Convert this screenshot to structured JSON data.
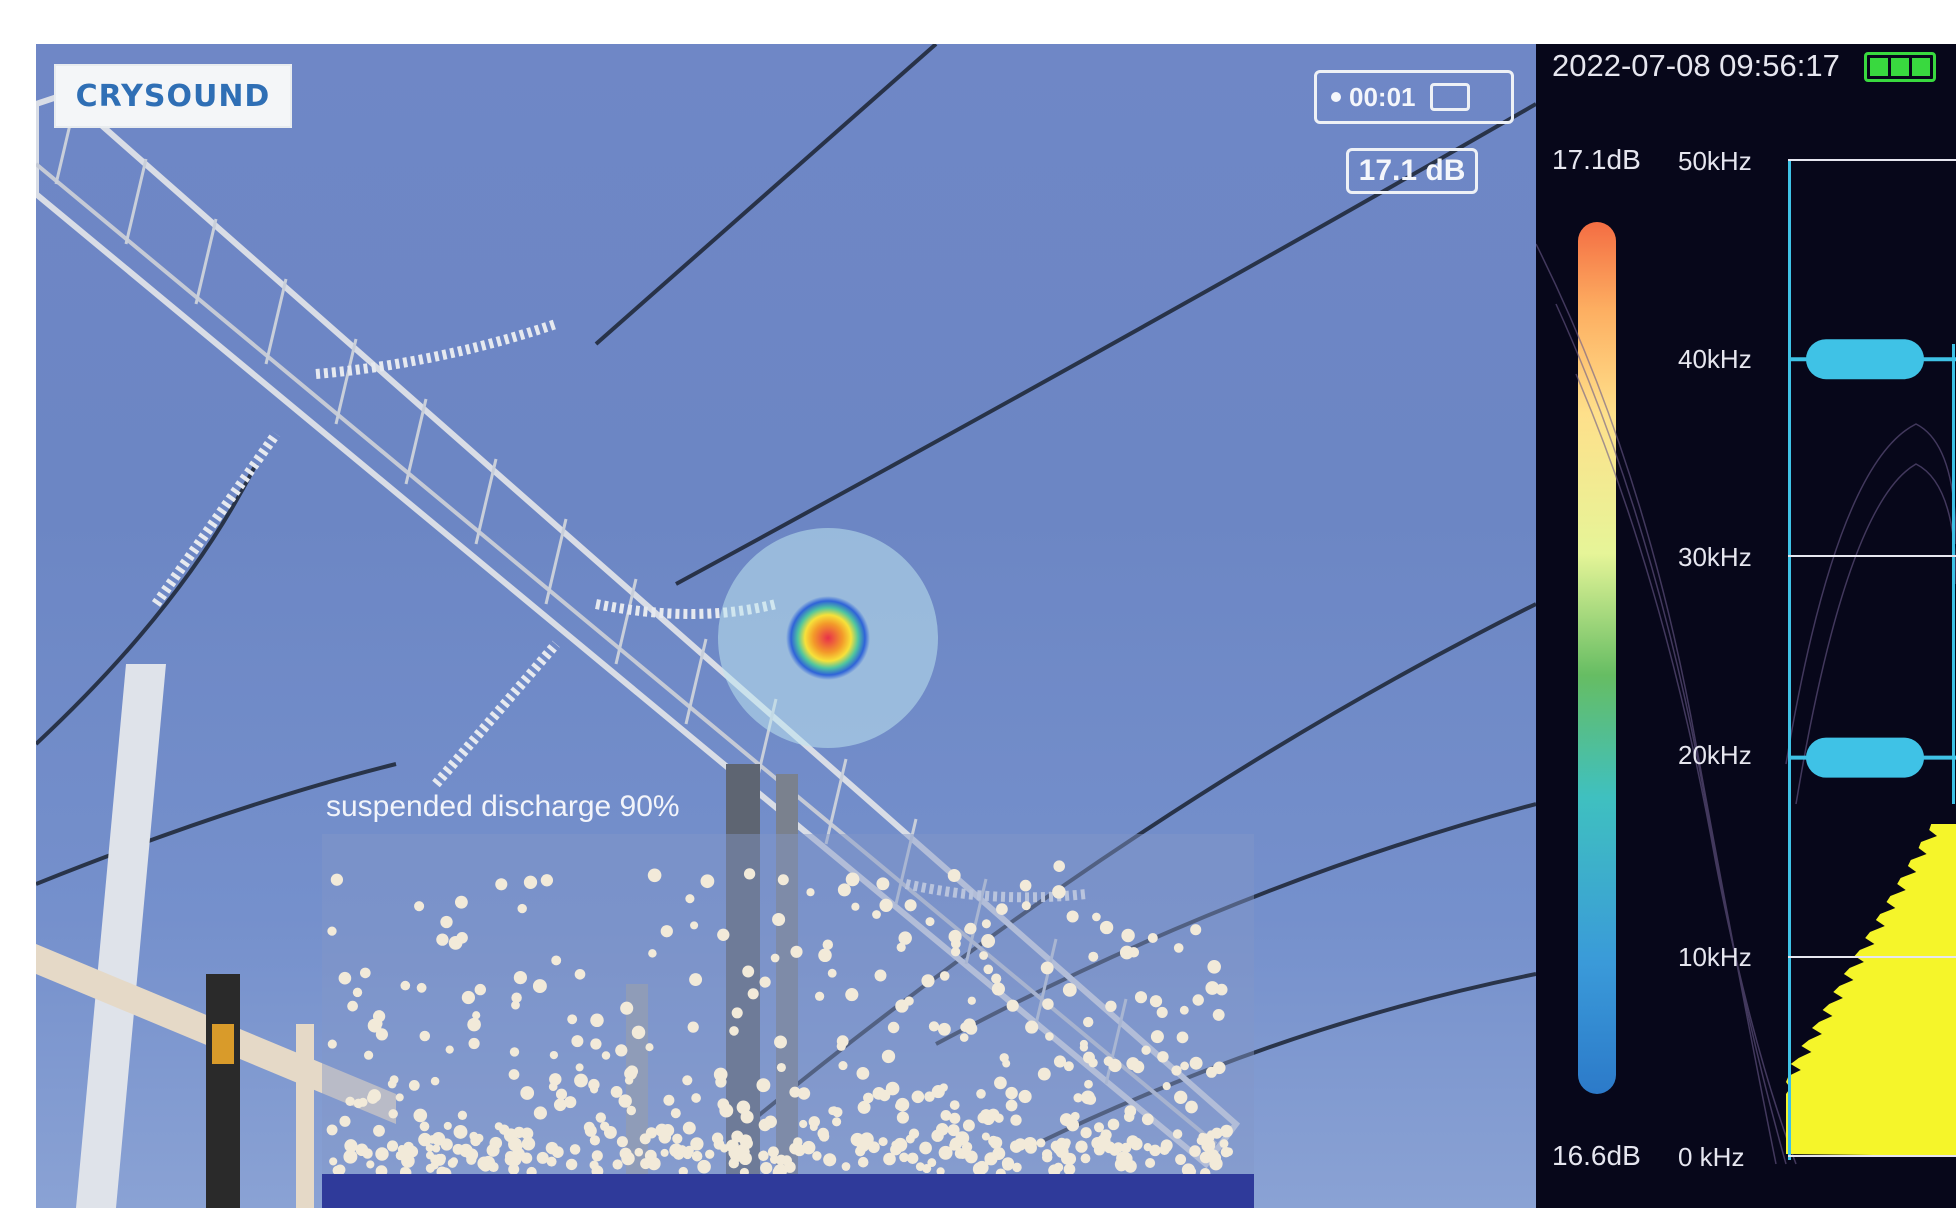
{
  "logo": {
    "text": "CRYSOUND"
  },
  "recording": {
    "timer": "00:01",
    "icon": "camera-icon"
  },
  "level_readout": "17.1 dB",
  "detection": {
    "label": "suspended discharge   90%"
  },
  "panel": {
    "datetime": "2022-07-08 09:56:17",
    "battery_icon": "battery-full-icon",
    "db_max": "17.1dB",
    "db_min": "16.6dB",
    "freq_labels": [
      "50kHz",
      "40kHz",
      "30kHz",
      "20kHz",
      "10kHz",
      "0 kHz"
    ],
    "filter_bands_khz": [
      40,
      20
    ]
  },
  "colors": {
    "accent": "#3fc2e6",
    "spectrum": "#f5f52a",
    "panel_bg": "#07071a"
  }
}
